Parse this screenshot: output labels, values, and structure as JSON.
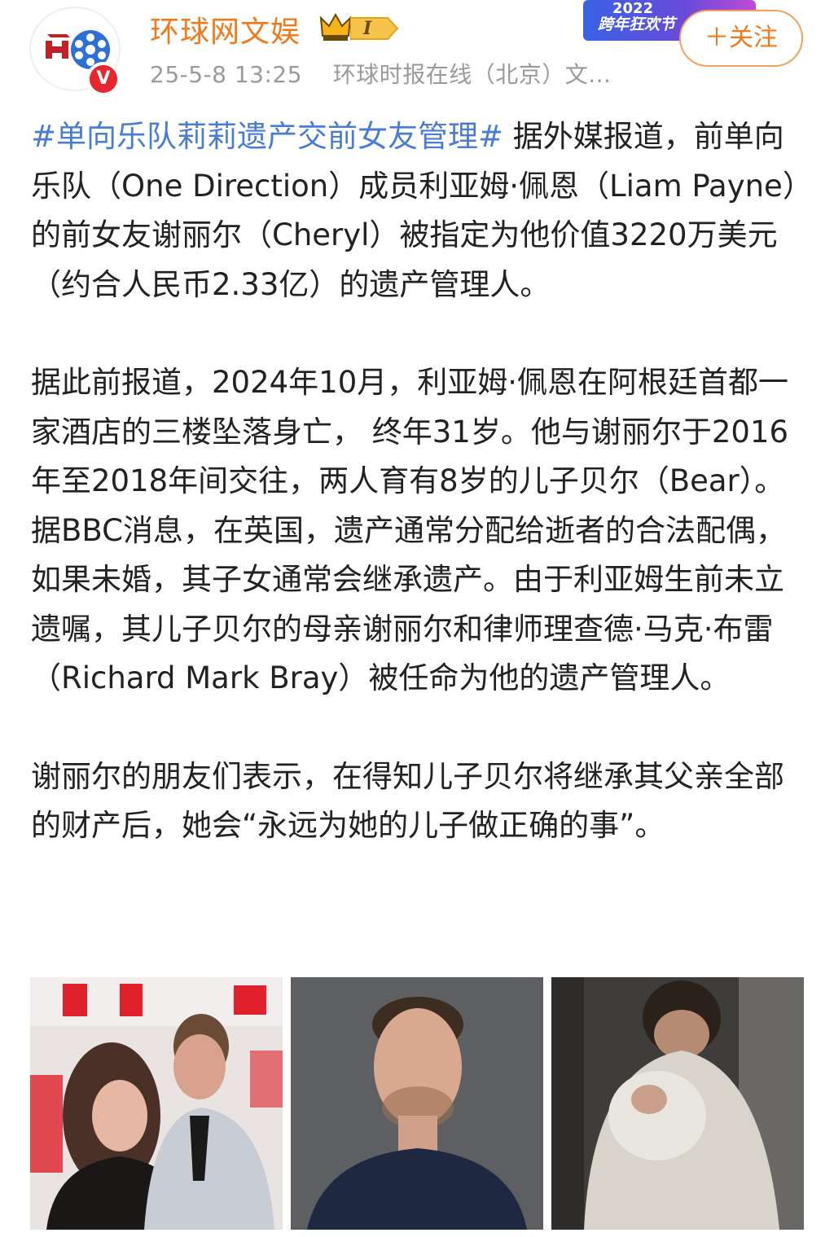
{
  "account": {
    "name": "环球网文娱",
    "level": "I",
    "verified_mark": "V",
    "timestamp": "25-5-8 13:25",
    "source": "环球时报在线（北京）文...",
    "follow_label": "＋关注"
  },
  "festival_badge": {
    "year": "2022",
    "name": "跨年狂欢节"
  },
  "post": {
    "hashtag": "#单向乐队莉莉遗产交前女友管理#",
    "p1_rest": " 据外媒报道，前单向乐队（One Direction）成员利亚姆·佩恩（Liam Payne）的前女友谢丽尔（Cheryl）被指定为他价值3220万美元（约合人民币2.33亿）的遗产管理人。",
    "p2": "据此前报道，2024年10月，利亚姆·佩恩在阿根廷首都一家酒店的三楼坠落身亡， 终年31岁。他与谢丽尔于2016年至2018年间交往，两人育有8岁的儿子贝尔（Bear）。据BBC消息，在英国，遗产通常分配给逝者的合法配偶，如果未婚，其子女通常会继承遗产。由于利亚姆生前未立遗嘱，其儿子贝尔的母亲谢丽尔和律师理查德·马克·布雷（Richard Mark Bray）被任命为他的遗产管理人。",
    "p3": "谢丽尔的朋友们表示，在得知儿子贝尔将继承其父亲全部的财产后，她会“永远为她的儿子做正确的事”。"
  },
  "photos": [
    {
      "alt": "couple-at-awards-photo",
      "watermark": ""
    },
    {
      "alt": "portrait-photo",
      "watermark": ""
    },
    {
      "alt": "holding-baby-photo",
      "watermark": ""
    }
  ],
  "colors": {
    "accent": "#f07a1b",
    "hashtag": "#4a7dd2",
    "verified": "#e8262d"
  }
}
